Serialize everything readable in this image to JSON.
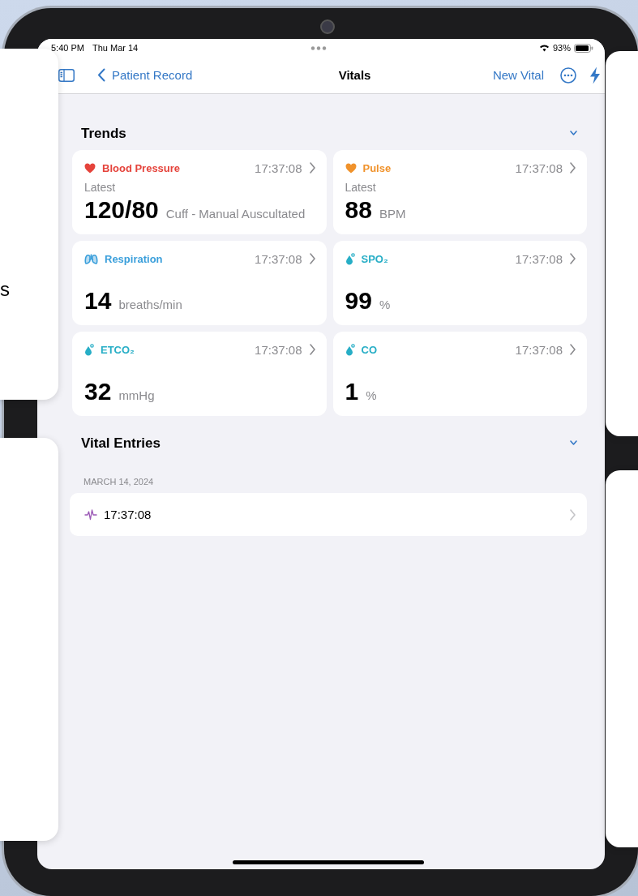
{
  "status_bar": {
    "time": "5:40 PM",
    "date": "Thu Mar 14",
    "battery": "93%"
  },
  "nav_bar": {
    "back": "Patient Record",
    "title": "Vitals",
    "action": "New Vital"
  },
  "trends": {
    "title": "Trends",
    "expanded": true,
    "cards": [
      {
        "kind": "heart",
        "title": "Blood Pressure",
        "color": "#e5433b",
        "time": "17:37:08",
        "latest": "Latest",
        "value": "120/80",
        "unit": "Cuff - Manual Auscultated"
      },
      {
        "kind": "heart",
        "title": "Pulse",
        "color": "#f0922b",
        "time": "17:37:08",
        "latest": "Latest",
        "value": "88",
        "unit": "BPM"
      },
      {
        "kind": "lungs",
        "title": "Respiration",
        "color": "#3a9fdb",
        "time": "17:37:08",
        "value": "14",
        "unit": "breaths/min"
      },
      {
        "kind": "drop",
        "title": "SPO₂",
        "color": "#27aec6",
        "time": "17:37:08",
        "value": "99",
        "unit": "%"
      },
      {
        "kind": "drop",
        "title": "ETCO₂",
        "color": "#27aec6",
        "time": "17:37:08",
        "value": "32",
        "unit": "mmHg"
      },
      {
        "kind": "drop",
        "title": "CO",
        "color": "#27aec6",
        "time": "17:37:08",
        "value": "1",
        "unit": "%"
      }
    ]
  },
  "entries": {
    "title": "Vital Entries",
    "expanded": true,
    "groups": [
      {
        "date": "MARCH 14, 2024",
        "rows": [
          {
            "time": "17:37:08"
          }
        ]
      }
    ]
  },
  "side_windows": [
    {
      "kind": "left",
      "text": "s"
    },
    {
      "kind": "left"
    },
    {
      "kind": "right"
    },
    {
      "kind": "right"
    }
  ]
}
